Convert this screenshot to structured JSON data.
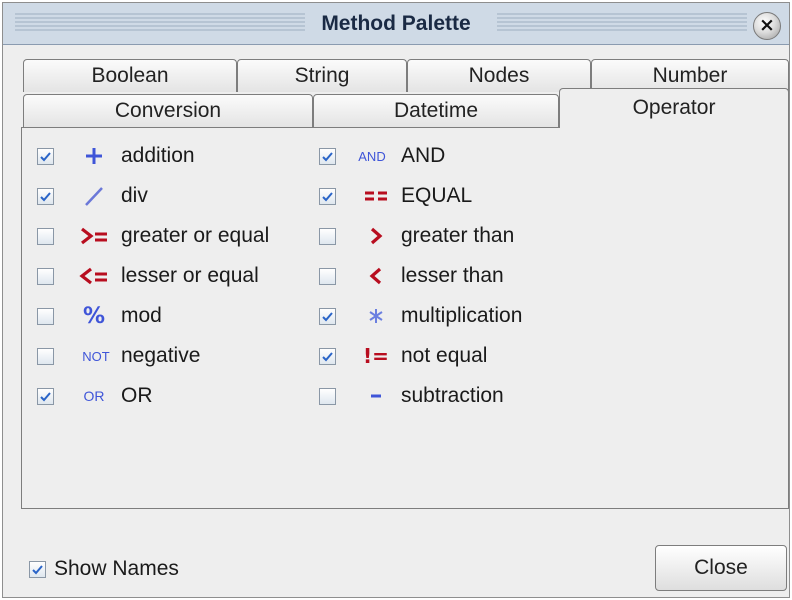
{
  "window": {
    "title": "Method Palette",
    "close_glyph": "×"
  },
  "tabs_row1": [
    {
      "label": "Boolean"
    },
    {
      "label": "String"
    },
    {
      "label": "Nodes"
    },
    {
      "label": "Number"
    }
  ],
  "tabs_row2": [
    {
      "label": "Conversion"
    },
    {
      "label": "Datetime"
    },
    {
      "label": "Operator",
      "selected": true
    }
  ],
  "operators": {
    "left": [
      {
        "label": "addition",
        "symbol": "+",
        "icon": "plus-icon",
        "checked": true
      },
      {
        "label": "div",
        "symbol": "/",
        "icon": "slash-icon",
        "checked": true
      },
      {
        "label": "greater or equal",
        "symbol": ">=",
        "icon": "greater-or-equal-icon",
        "checked": false
      },
      {
        "label": "lesser or equal",
        "symbol": "<=",
        "icon": "lesser-or-equal-icon",
        "checked": false
      },
      {
        "label": "mod",
        "symbol": "%",
        "icon": "percent-icon",
        "checked": false
      },
      {
        "label": "negative",
        "symbol": "NOT",
        "icon": "not-icon",
        "checked": false
      },
      {
        "label": "OR",
        "symbol": "OR",
        "icon": "or-icon",
        "checked": true
      }
    ],
    "right": [
      {
        "label": "AND",
        "symbol": "AND",
        "icon": "and-icon",
        "checked": true
      },
      {
        "label": "EQUAL",
        "symbol": "==",
        "icon": "equal-icon",
        "checked": true
      },
      {
        "label": "greater than",
        "symbol": ">",
        "icon": "greater-than-icon",
        "checked": false
      },
      {
        "label": "lesser than",
        "symbol": "<",
        "icon": "lesser-than-icon",
        "checked": false
      },
      {
        "label": "multiplication",
        "symbol": "*",
        "icon": "asterisk-icon",
        "checked": true
      },
      {
        "label": "not equal",
        "symbol": "!=",
        "icon": "not-equal-icon",
        "checked": true
      },
      {
        "label": "subtraction",
        "symbol": "-",
        "icon": "minus-icon",
        "checked": false
      }
    ]
  },
  "footer": {
    "show_names_label": "Show Names",
    "show_names_checked": true,
    "close_label": "Close"
  },
  "colors": {
    "blue": "#3f55d8",
    "red": "#b80d1f",
    "titlebar": "#cfdae6"
  }
}
